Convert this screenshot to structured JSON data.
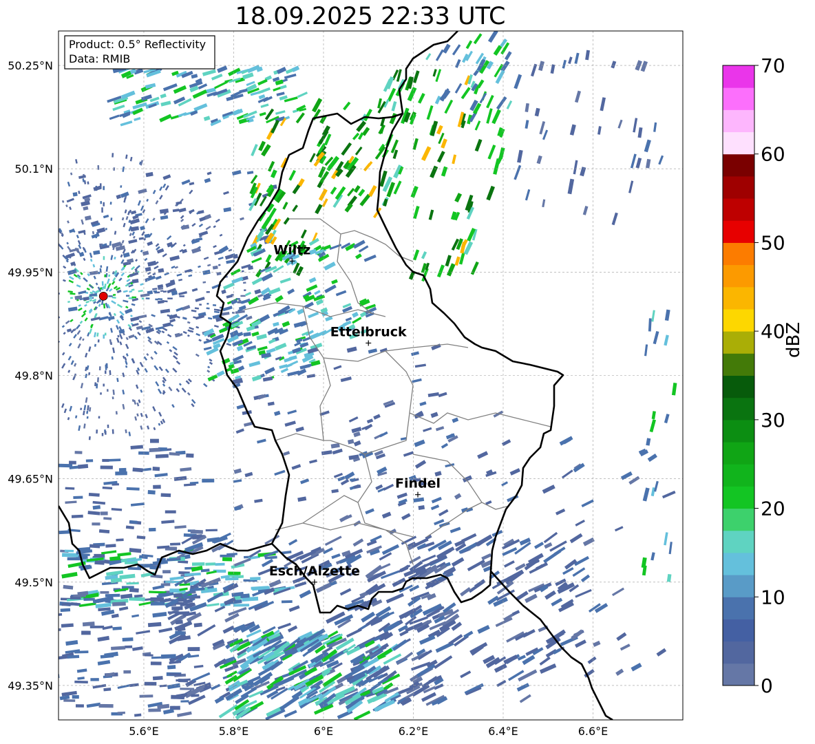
{
  "title": "18.09.2025 22:33 UTC",
  "info_box": {
    "line1": "Product: 0.5° Reflectivity",
    "line2": "Data: RMIB"
  },
  "map": {
    "lon_range": [
      5.41,
      6.8
    ],
    "lat_range": [
      49.3,
      50.3
    ],
    "lon_ticks": [
      {
        "v": 5.6,
        "label": "5.6°E"
      },
      {
        "v": 5.8,
        "label": "5.8°E"
      },
      {
        "v": 6.0,
        "label": "6°E"
      },
      {
        "v": 6.2,
        "label": "6.2°E"
      },
      {
        "v": 6.4,
        "label": "6.4°E"
      },
      {
        "v": 6.6,
        "label": "6.6°E"
      }
    ],
    "lat_ticks": [
      {
        "v": 49.35,
        "label": "49.35°N"
      },
      {
        "v": 49.5,
        "label": "49.5°N"
      },
      {
        "v": 49.65,
        "label": "49.65°N"
      },
      {
        "v": 49.8,
        "label": "49.8°N"
      },
      {
        "v": 49.95,
        "label": "49.95°N"
      },
      {
        "v": 50.1,
        "label": "50.1°N"
      },
      {
        "v": 50.25,
        "label": "50.25°N"
      }
    ],
    "grid": true,
    "radar_site": {
      "lon": 5.51,
      "lat": 49.915,
      "color": "#e00000"
    },
    "cities": [
      {
        "name": "Wiltz",
        "lon": 5.93,
        "lat": 49.966
      },
      {
        "name": "Ettelbruck",
        "lon": 6.1,
        "lat": 49.847
      },
      {
        "name": "Findel",
        "lon": 6.21,
        "lat": 49.627
      },
      {
        "name": "Esch/Alzette",
        "lon": 5.98,
        "lat": 49.5
      }
    ]
  },
  "colorbar": {
    "label": "dBZ",
    "ticks": [
      "0",
      "10",
      "20",
      "30",
      "40",
      "50",
      "60",
      "70"
    ],
    "min": 0,
    "max": 70,
    "step": 2.5,
    "colors": [
      "#6577a6",
      "#52679f",
      "#4460a3",
      "#4a72ad",
      "#599bc7",
      "#64c0dc",
      "#5fd3c1",
      "#3dd16c",
      "#13c523",
      "#11b41c",
      "#10a515",
      "#0c8e12",
      "#0a7410",
      "#075b0b",
      "#437a08",
      "#aaae06",
      "#fdd700",
      "#fbb600",
      "#fc9a00",
      "#fc7c00",
      "#e70000",
      "#be0000",
      "#9f0000",
      "#7a0000",
      "#fee0fe",
      "#fdb6fd",
      "#fc6ffc",
      "#ea35ea"
    ]
  }
}
